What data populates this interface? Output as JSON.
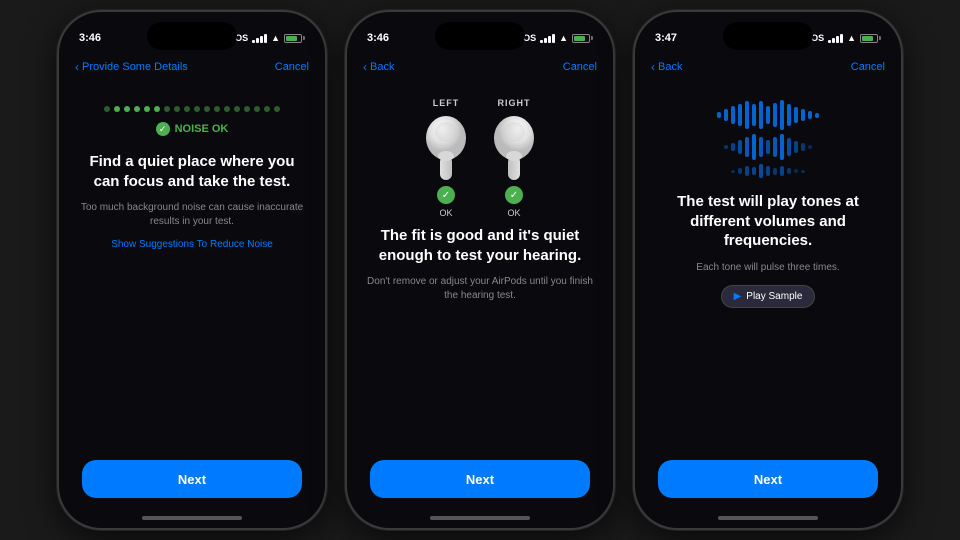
{
  "background": "#1a1a1a",
  "phones": [
    {
      "id": "phone-1",
      "statusBar": {
        "time": "3:46",
        "sos": "SOS",
        "hasBell": true
      },
      "nav": {
        "back": "Provide Some Details",
        "cancel": "Cancel"
      },
      "content": {
        "type": "noise",
        "noiseStatus": "NOISE OK",
        "heading": "Find a quiet place where you can focus and take the test.",
        "subText": "Too much background noise can cause inaccurate results in your test.",
        "linkText": "Show Suggestions To Reduce Noise"
      },
      "nextButton": "Next"
    },
    {
      "id": "phone-2",
      "statusBar": {
        "time": "3:46",
        "sos": "SOS",
        "hasBell": true
      },
      "nav": {
        "back": "Back",
        "cancel": "Cancel"
      },
      "content": {
        "type": "airpods",
        "leftLabel": "LEFT",
        "rightLabel": "RIGHT",
        "leftStatus": "OK",
        "rightStatus": "OK",
        "heading": "The fit is good and it's quiet enough to test your hearing.",
        "subText": "Don't remove or adjust your AirPods until you finish the hearing test."
      },
      "nextButton": "Next"
    },
    {
      "id": "phone-3",
      "statusBar": {
        "time": "3:47",
        "sos": "SOS",
        "hasBell": true
      },
      "nav": {
        "back": "Back",
        "cancel": "Cancel"
      },
      "content": {
        "type": "tones",
        "heading": "The test will play tones at different volumes and frequencies.",
        "subText": "Each tone will pulse three times.",
        "playSampleLabel": "Play Sample"
      },
      "nextButton": "Next"
    }
  ]
}
